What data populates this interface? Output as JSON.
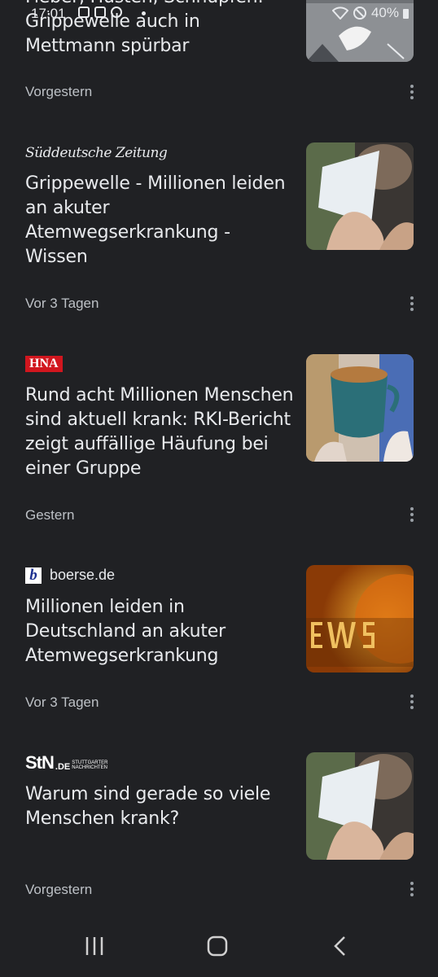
{
  "status_bar": {
    "time": "17:01",
    "battery": "40%"
  },
  "articles": [
    {
      "title": "Fieber, Husten, Schnupfen: Grippewelle auch in Mettmann spürbar",
      "time": "Vorgestern"
    },
    {
      "source": "Süddeutsche Zeitung",
      "title": "Grippewelle - Millionen leiden an akuter Atemwegserkrankung - Wissen",
      "time": "Vor 3 Tagen"
    },
    {
      "source": "HNA",
      "title": "Rund acht Millionen Menschen sind aktuell krank: RKI-Bericht zeigt auffällige Häufung bei einer Gruppe",
      "time": "Gestern"
    },
    {
      "source": "boerse.de",
      "source_logo": "b",
      "title": "Millionen leiden in Deutschland an akuter Atemwegserkrankung",
      "time": "Vor 3 Tagen"
    },
    {
      "source_big": "StN",
      "source_suffix": ".DE",
      "source_tag1": "STUTTGARTER",
      "source_tag2": "NACHRICHTEN",
      "title": "Warum sind gerade so viele Menschen krank?",
      "time": "Vorgestern"
    }
  ],
  "icons": {
    "more": "more-vert-icon",
    "recents": "recents-icon",
    "home": "home-icon",
    "back": "back-icon"
  }
}
